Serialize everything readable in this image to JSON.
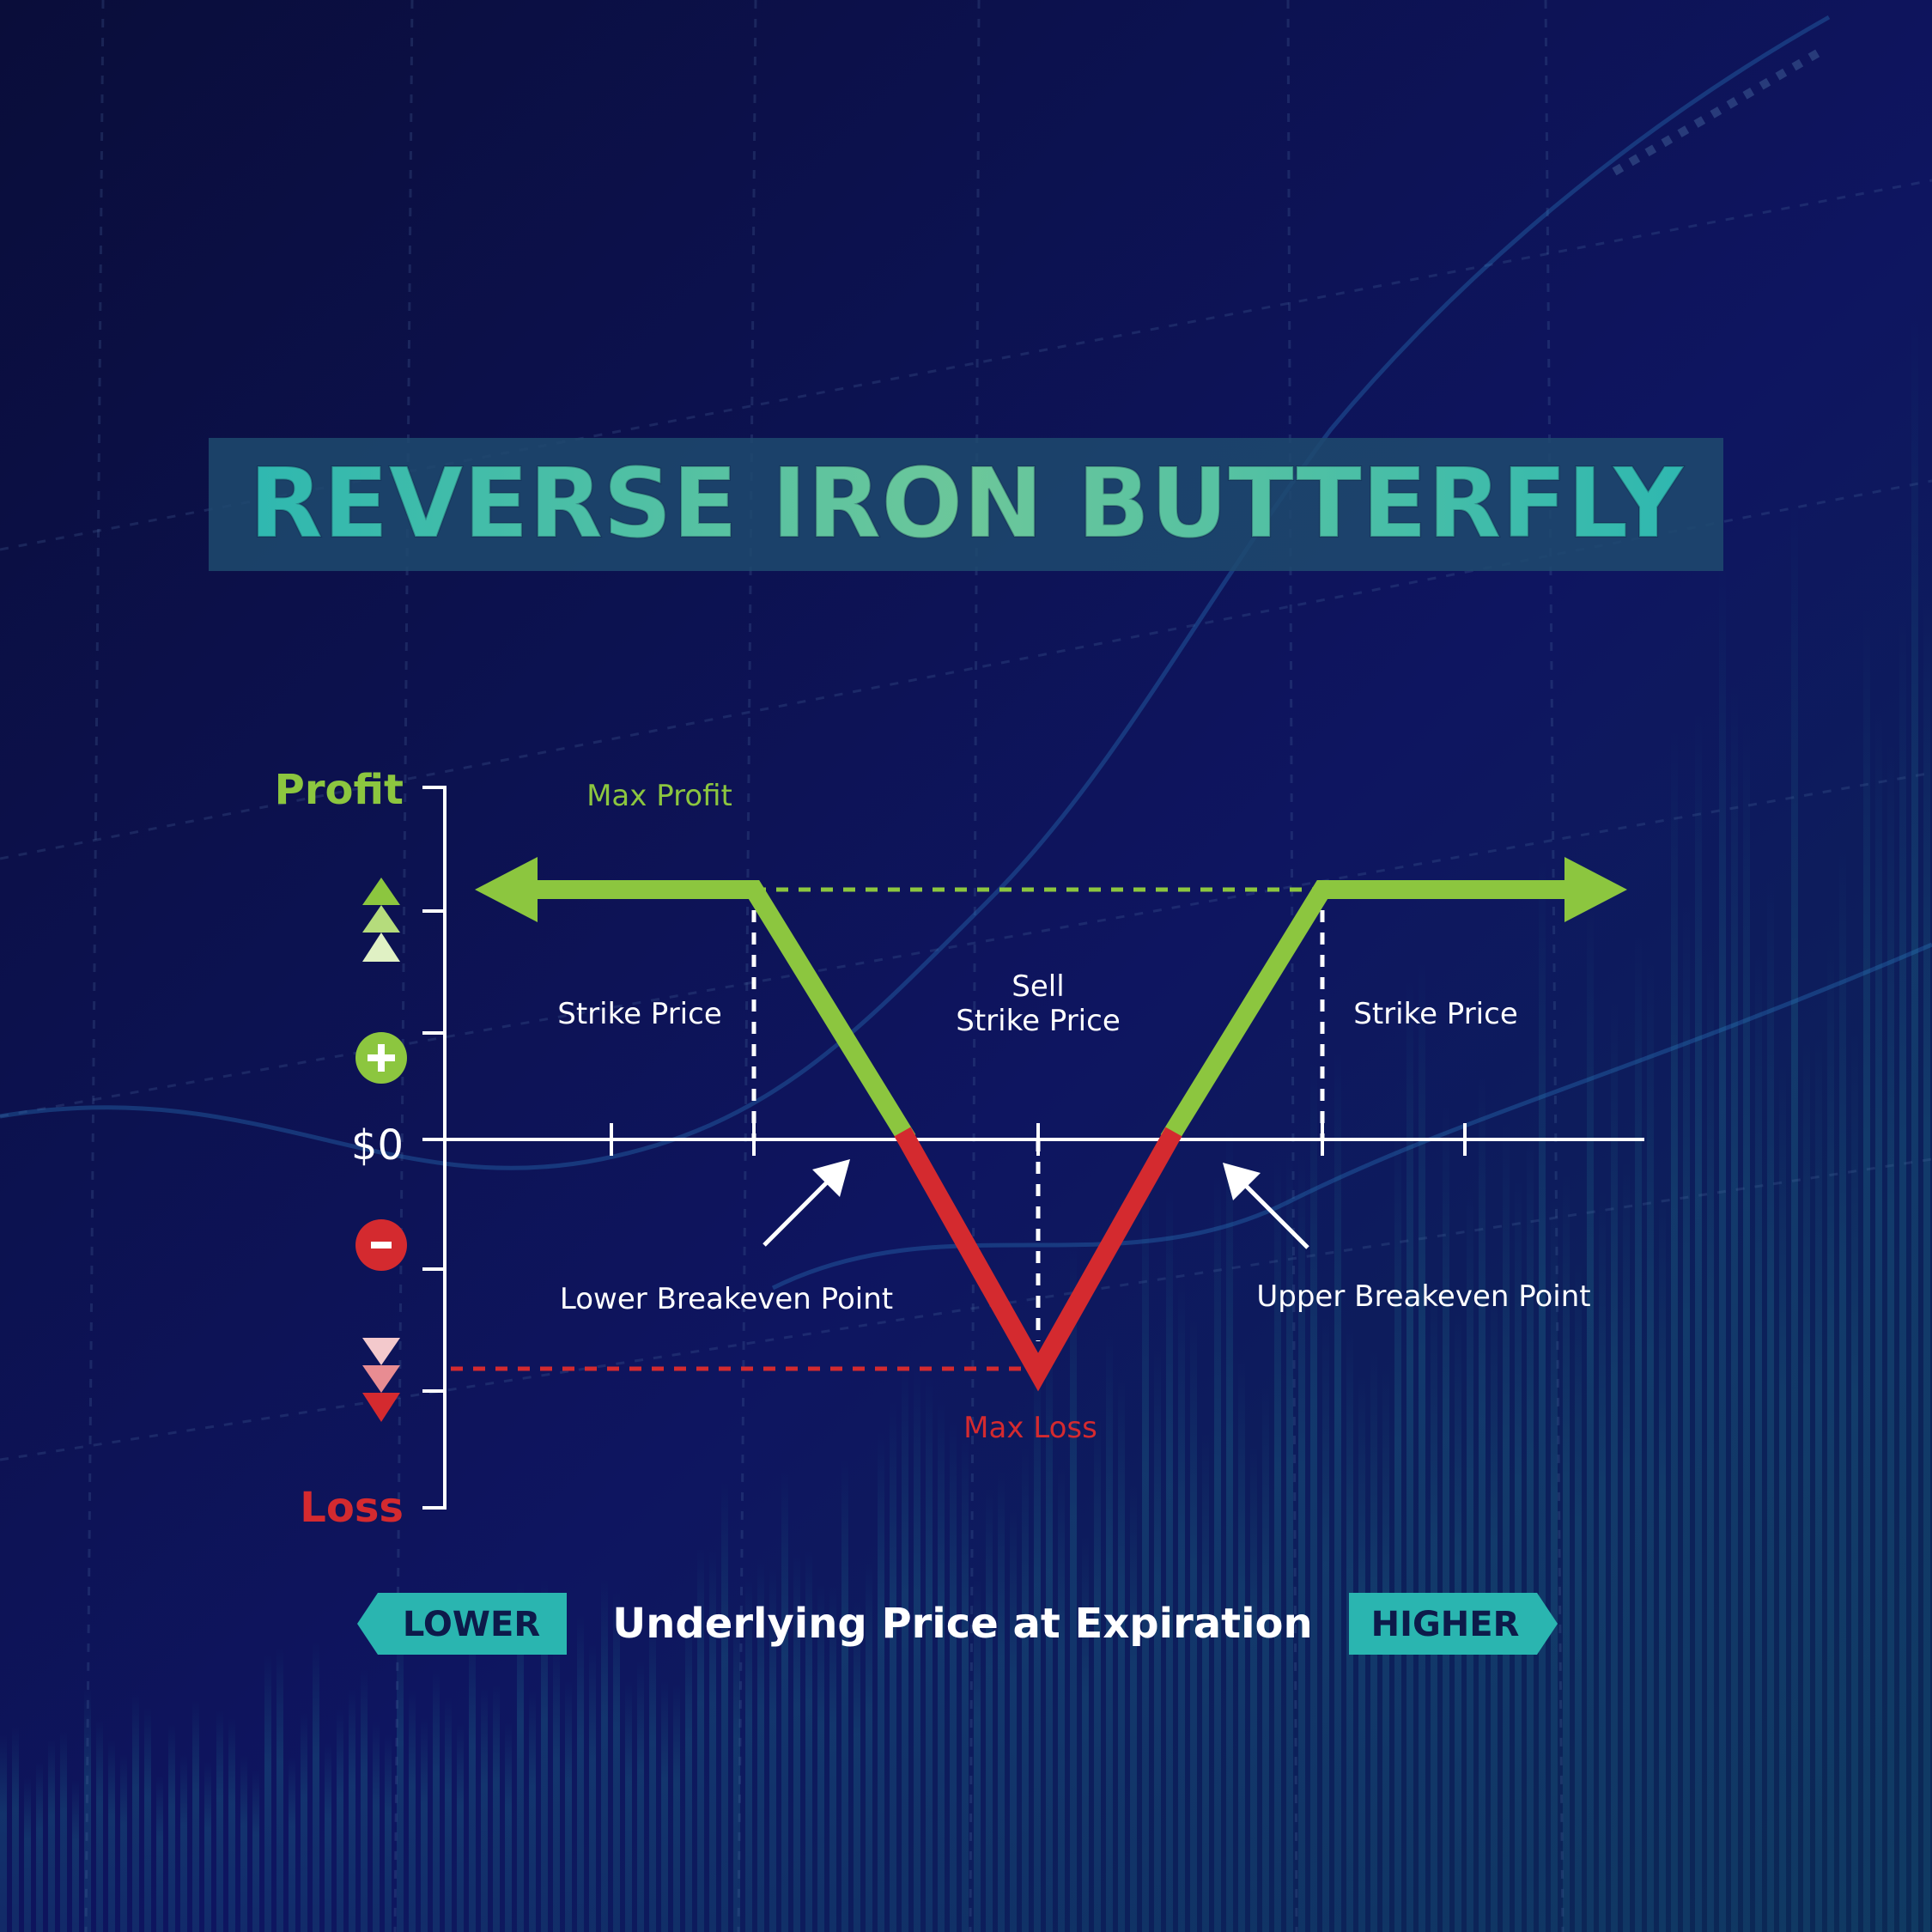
{
  "title": "REVERSE IRON BUTTERFLY",
  "axis": {
    "profit_label": "Profit",
    "loss_label": "Loss",
    "zero_label": "$0",
    "x_label": "Underlying Price at Expiration",
    "lower_label": "LOWER",
    "higher_label": "HIGHER"
  },
  "annotations": {
    "max_profit": "Max Profit",
    "max_loss": "Max Loss",
    "strike_left": "Strike Price",
    "sell_strike_line1": "Sell",
    "sell_strike_line2": "Strike Price",
    "strike_right": "Strike Price",
    "lower_breakeven": "Lower Breakeven Point",
    "upper_breakeven": "Upper Breakeven Point"
  },
  "colors": {
    "background": "#0d1150",
    "title_bar": "#1e4a6e",
    "title_text": "#3fc4a8",
    "profit_green": "#8cc63f",
    "loss_red": "#d42a2f",
    "badge_teal": "#2ab5b0",
    "text_white": "#ffffff"
  },
  "icons": [
    "triangle-up-stack-icon",
    "plus-circle-icon",
    "minus-circle-icon",
    "triangle-down-stack-icon",
    "arrow-left-icon",
    "arrow-right-icon"
  ],
  "chart_data": {
    "type": "line",
    "x": [
      0,
      1,
      2,
      3,
      4
    ],
    "y": [
      1,
      1,
      -1,
      1,
      1
    ],
    "x_ticks": [
      "",
      "Strike Price",
      "Sell Strike Price",
      "Strike Price",
      ""
    ],
    "zero_line": true
  }
}
